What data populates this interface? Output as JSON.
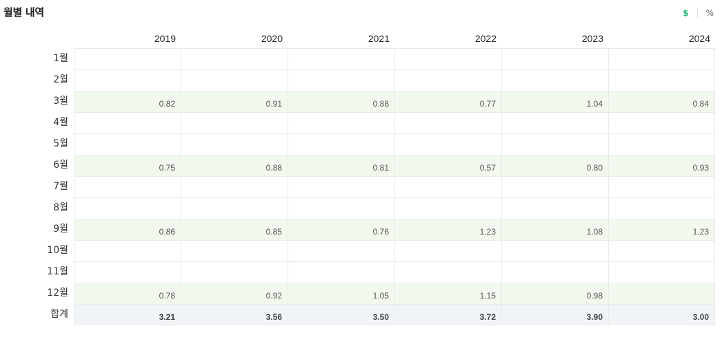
{
  "header": {
    "title": "월별 내역",
    "unit_dollar": "$",
    "unit_percent": "%"
  },
  "colors": {
    "active_unit": "#2bb673",
    "dividend_row_bg": "#f1f9ee",
    "total_row_bg": "#f1f4f7"
  },
  "table": {
    "years": [
      "2019",
      "2020",
      "2021",
      "2022",
      "2023",
      "2024"
    ],
    "rows": [
      {
        "label": "1월",
        "values": [
          "",
          "",
          "",
          "",
          "",
          ""
        ]
      },
      {
        "label": "2월",
        "values": [
          "",
          "",
          "",
          "",
          "",
          ""
        ]
      },
      {
        "label": "3월",
        "values": [
          "0.82",
          "0.91",
          "0.88",
          "0.77",
          "1.04",
          "0.84"
        ]
      },
      {
        "label": "4월",
        "values": [
          "",
          "",
          "",
          "",
          "",
          ""
        ]
      },
      {
        "label": "5월",
        "values": [
          "",
          "",
          "",
          "",
          "",
          ""
        ]
      },
      {
        "label": "6월",
        "values": [
          "0.75",
          "0.88",
          "0.81",
          "0.57",
          "0.80",
          "0.93"
        ]
      },
      {
        "label": "7월",
        "values": [
          "",
          "",
          "",
          "",
          "",
          ""
        ]
      },
      {
        "label": "8월",
        "values": [
          "",
          "",
          "",
          "",
          "",
          ""
        ]
      },
      {
        "label": "9월",
        "values": [
          "0.86",
          "0.85",
          "0.76",
          "1.23",
          "1.08",
          "1.23"
        ]
      },
      {
        "label": "10월",
        "values": [
          "",
          "",
          "",
          "",
          "",
          ""
        ]
      },
      {
        "label": "11월",
        "values": [
          "",
          "",
          "",
          "",
          "",
          ""
        ]
      },
      {
        "label": "12월",
        "values": [
          "0.78",
          "0.92",
          "1.05",
          "1.15",
          "0.98",
          ""
        ]
      }
    ],
    "total": {
      "label": "합계",
      "values": [
        "3.21",
        "3.56",
        "3.50",
        "3.72",
        "3.90",
        "3.00"
      ]
    }
  }
}
